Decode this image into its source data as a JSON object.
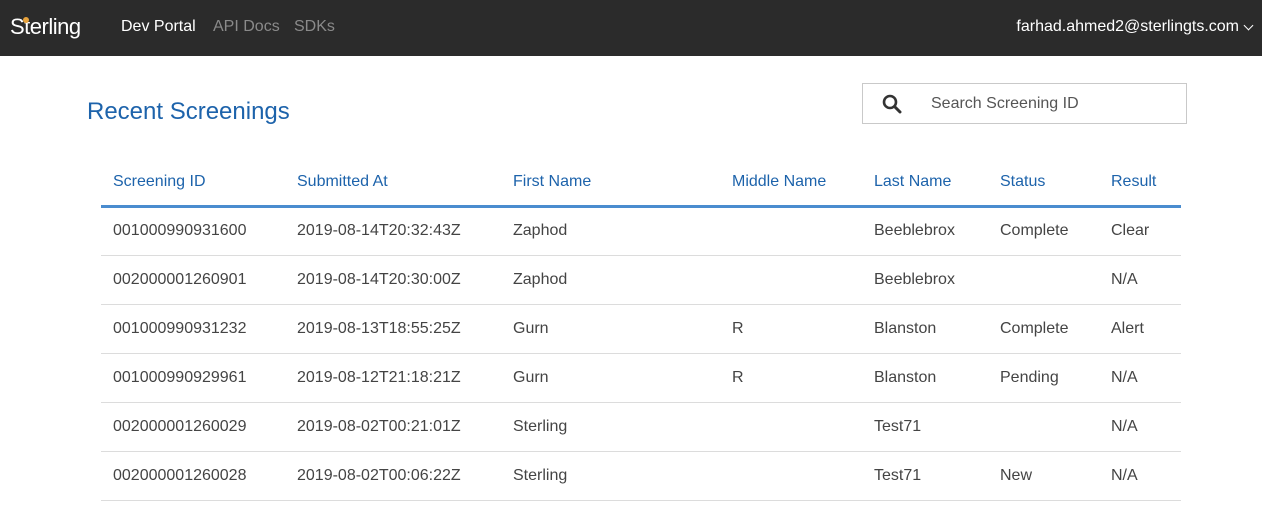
{
  "nav": {
    "logo": "Sterling",
    "links": [
      "Dev Portal",
      "API Docs",
      "SDKs"
    ],
    "user": "farhad.ahmed2@sterlingts.com"
  },
  "page": {
    "title": "Recent Screenings"
  },
  "search": {
    "placeholder": "Search Screening ID",
    "value": ""
  },
  "table": {
    "headers": [
      "Screening ID",
      "Submitted At",
      "First Name",
      "Middle Name",
      "Last Name",
      "Status",
      "Result"
    ],
    "rows": [
      [
        "001000990931600",
        "2019-08-14T20:32:43Z",
        "Zaphod",
        "",
        "Beeblebrox",
        "Complete",
        "Clear"
      ],
      [
        "002000001260901",
        "2019-08-14T20:30:00Z",
        "Zaphod",
        "",
        "Beeblebrox",
        "",
        "N/A"
      ],
      [
        "001000990931232",
        "2019-08-13T18:55:25Z",
        "Gurn",
        "R",
        "Blanston",
        "Complete",
        "Alert"
      ],
      [
        "001000990929961",
        "2019-08-12T21:18:21Z",
        "Gurn",
        "R",
        "Blanston",
        "Pending",
        "N/A"
      ],
      [
        "002000001260029",
        "2019-08-02T00:21:01Z",
        "Sterling",
        "",
        "Test71",
        "",
        "N/A"
      ],
      [
        "002000001260028",
        "2019-08-02T00:06:22Z",
        "Sterling",
        "",
        "Test71",
        "New",
        "N/A"
      ]
    ]
  },
  "colors": {
    "navbar": "#2b2b2b",
    "accent": "#1d63ab",
    "rule": "#4a8ccf",
    "logo_dot": "#e8a33c"
  }
}
